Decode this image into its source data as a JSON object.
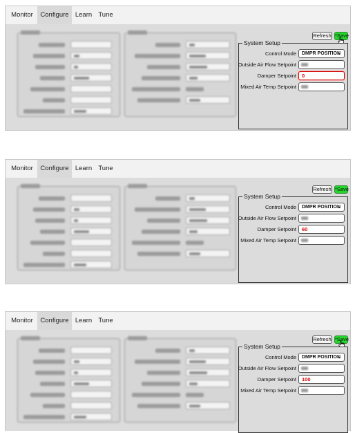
{
  "tabs": [
    "Monitor",
    "Configure",
    "Learn",
    "Tune"
  ],
  "active_tab": "Configure",
  "buttons": {
    "refresh": "Refresh",
    "save": "*Save"
  },
  "system_setup": {
    "title": "System Setup",
    "control_mode_label": "Control Mode",
    "control_mode_value": "DMPR POSITION",
    "outside_air_label": "Outside Air Flow Setpoint",
    "damper_label": "Damper Setpoint",
    "mixed_air_label": "Mixed Air Temp Setpoint"
  },
  "screens": [
    {
      "damper_value": "0"
    },
    {
      "damper_value": "60"
    },
    {
      "damper_value": "100"
    }
  ],
  "colors": {
    "save_green": "#25d62e",
    "value_red": "#d40000"
  }
}
